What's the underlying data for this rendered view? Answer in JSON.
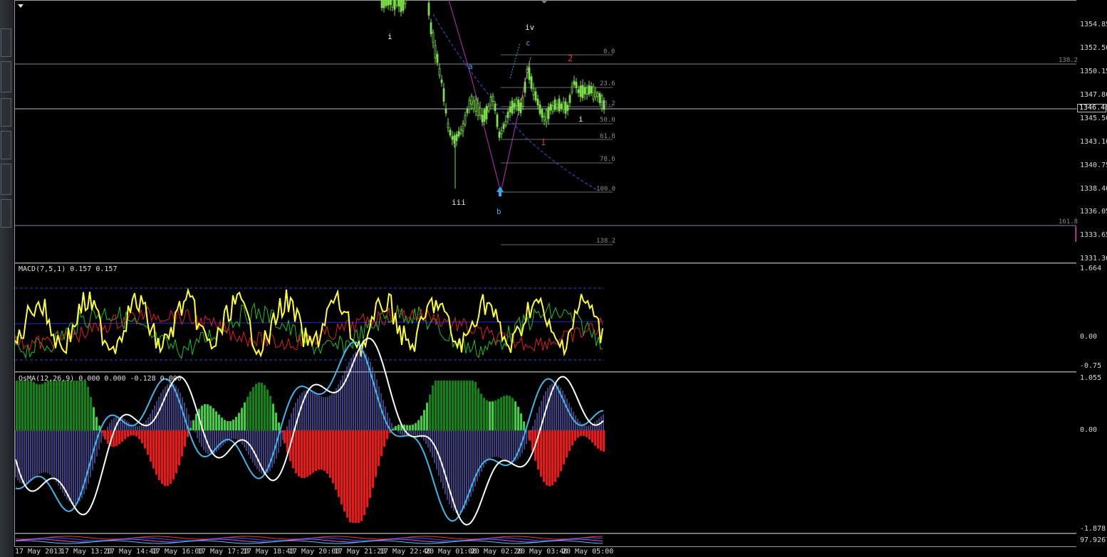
{
  "price_axis": {
    "ticks": [
      "1354.85",
      "1352.50",
      "1350.15",
      "1347.80",
      "1345.50",
      "1343.10",
      "1340.75",
      "1338.40",
      "1336.05",
      "1333.65",
      "1331.30"
    ],
    "current_price": "1346.48"
  },
  "main_chart": {
    "wave_labels": {
      "i_top": "i",
      "iv": "iv",
      "c": "c",
      "a": "a",
      "two": "2",
      "i_mid": "i",
      "one": "1",
      "iii": "iii",
      "b": "b"
    },
    "fib_levels": [
      "0.0",
      "23.6",
      "38.2",
      "50.0",
      "61.8",
      "78.6",
      "100.0",
      "138.2"
    ],
    "fib_right": [
      "138.2",
      "161.8"
    ]
  },
  "macd_pane": {
    "label": "MACD(7,5,1) 0.157 0.157",
    "ticks": [
      "1.664",
      "0.00",
      "-0.75"
    ]
  },
  "osma_pane": {
    "label": "OsMA(12,26,9) 0.000 0.000 -0.128 0.000",
    "ticks": [
      "1.055",
      "0.00",
      "-1.878"
    ]
  },
  "bottom_pane": {
    "ticks": [
      "97.926731"
    ]
  },
  "time_axis": [
    "17 May 2013",
    "17 May 13:20",
    "17 May 14:40",
    "17 May 16:00",
    "17 May 17:20",
    "17 May 18:40",
    "17 May 20:00",
    "17 May 21:20",
    "17 May 22:40",
    "20 May 01:00",
    "20 May 02:20",
    "20 May 03:40",
    "20 May 05:00"
  ],
  "colors": {
    "candles": "#7ee04a",
    "wave_blue": "#3aa8e8",
    "wave_red": "#e03a1e",
    "macd_main": "#ffff33",
    "macd_signal": "#e02020",
    "macd_green": "#20c020",
    "osma_pos_dark": "#0a8a0a",
    "osma_pos_light": "#36d636",
    "osma_neg": "#ff1010",
    "osma_line_cyan": "#3ab8f0",
    "osma_line_white": "#ffffff",
    "hist_purple": "#8080ff"
  }
}
